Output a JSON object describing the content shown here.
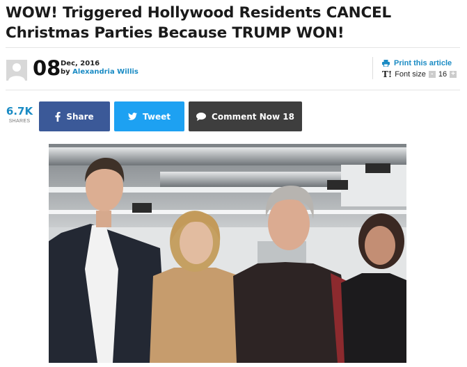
{
  "article": {
    "title": "WOW! Triggered Hollywood Residents CANCEL Christmas Parties Because TRUMP WON!"
  },
  "meta": {
    "day": "08",
    "month_year": "Dec, 2016",
    "by_label": "by",
    "author": "Alexandria Willis"
  },
  "tools": {
    "print_label": "Print this article",
    "fontsize_label": "Font size",
    "fontsize_icon": "T!",
    "fontsize_value": "16",
    "decrease_label": "-",
    "increase_label": "+"
  },
  "shares": {
    "count": "6.7K",
    "label": "SHARES"
  },
  "buttons": {
    "facebook": "Share",
    "twitter": "Tweet",
    "comment": "Comment Now 18"
  },
  "colors": {
    "accent": "#1a8bc4",
    "facebook": "#3b5998",
    "twitter": "#1da1f2",
    "comment": "#3e3e3e"
  },
  "icons": {
    "avatar": "default-avatar-icon",
    "print": "printer-icon",
    "font": "font-size-icon",
    "facebook": "facebook-icon",
    "twitter": "twitter-icon",
    "comment": "comment-bubble-icon"
  }
}
